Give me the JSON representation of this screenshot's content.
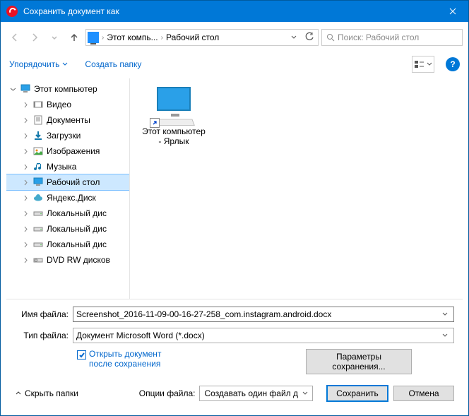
{
  "window": {
    "title": "Сохранить документ как"
  },
  "nav": {
    "path1": "Этот компь...",
    "path2": "Рабочий стол",
    "search_placeholder": "Поиск: Рабочий стол"
  },
  "toolbar": {
    "organize": "Упорядочить",
    "newfolder": "Создать папку"
  },
  "tree": {
    "root": "Этот компьютер",
    "items": [
      {
        "label": "Видео",
        "icon": "video"
      },
      {
        "label": "Документы",
        "icon": "doc"
      },
      {
        "label": "Загрузки",
        "icon": "download"
      },
      {
        "label": "Изображения",
        "icon": "image"
      },
      {
        "label": "Музыка",
        "icon": "music"
      },
      {
        "label": "Рабочий стол",
        "icon": "desktop",
        "selected": true
      },
      {
        "label": "Яндекс.Диск",
        "icon": "cloud"
      },
      {
        "label": "Локальный дис",
        "icon": "drive"
      },
      {
        "label": "Локальный дис",
        "icon": "drive"
      },
      {
        "label": "Локальный дис",
        "icon": "drive"
      },
      {
        "label": "DVD RW дисков",
        "icon": "dvd"
      }
    ]
  },
  "files": {
    "item1_line1": "Этот компьютер",
    "item1_line2": "- Ярлык"
  },
  "bottom": {
    "filename_label": "Имя файла:",
    "filename_value": "Screenshot_2016-11-09-00-16-27-258_com.instagram.android.docx",
    "filetype_label": "Тип файла:",
    "filetype_value": "Документ Microsoft Word (*.docx)",
    "open_after_l1": "Открыть документ",
    "open_after_l2": "после сохранения",
    "params_l1": "Параметры",
    "params_l2": "сохранения...",
    "hide_folders": "Скрыть папки",
    "file_options_label": "Опции файла:",
    "file_options_value": "Создавать один файл д",
    "save": "Сохранить",
    "cancel": "Отмена"
  }
}
